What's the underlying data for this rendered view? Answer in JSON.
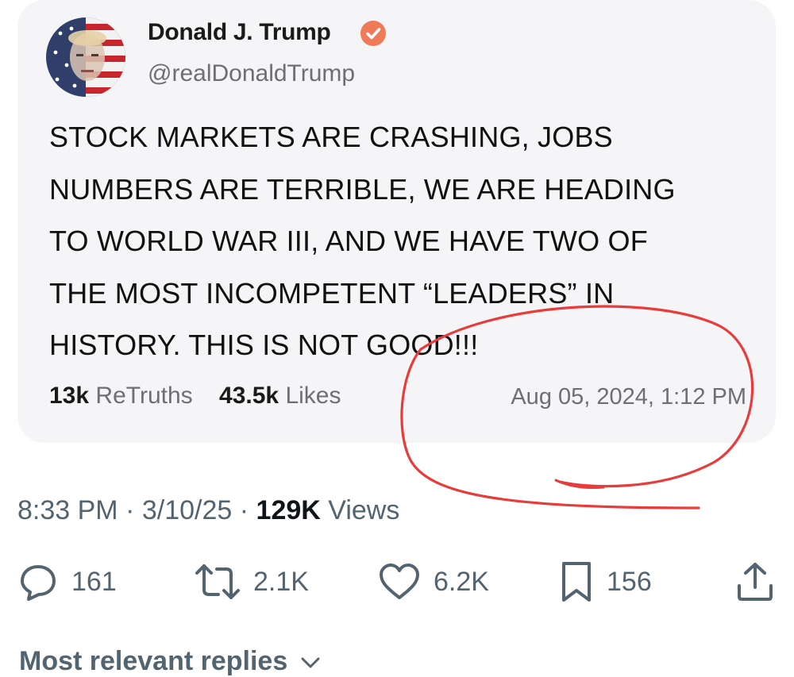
{
  "post": {
    "author_name": "Donald J. Trump",
    "author_handle": "@realDonaldTrump",
    "text_lines": [
      "STOCK MARKETS ARE CRASHING, JOBS",
      "NUMBERS ARE TERRIBLE, WE ARE HEADING",
      "TO WORLD WAR III, AND WE HAVE TWO OF",
      "THE MOST INCOMPETENT “LEADERS” IN",
      "HISTORY. THIS IS NOT GOOD!!!"
    ],
    "retruths_count": "13k",
    "retruths_label": "ReTruths",
    "likes_count": "43.5k",
    "likes_label": "Likes",
    "date": "Aug 05, 2024, 1:12 PM",
    "verified_badge_color": "#f07a57"
  },
  "annotation": {
    "color": "#e83b3b"
  },
  "tweet_meta": {
    "time": "8:33 PM",
    "separator": "·",
    "date": "3/10/25",
    "views_count": "129K",
    "views_label": "Views"
  },
  "actions": {
    "replies": {
      "icon": "comment-icon",
      "count": "161"
    },
    "reposts": {
      "icon": "repost-icon",
      "count": "2.1K"
    },
    "likes": {
      "icon": "heart-icon",
      "count": "6.2K"
    },
    "bookmarks": {
      "icon": "bookmark-icon",
      "count": "156"
    },
    "share": {
      "icon": "share-icon"
    },
    "icon_color": "#536471"
  },
  "replies_section": {
    "label": "Most relevant replies"
  }
}
